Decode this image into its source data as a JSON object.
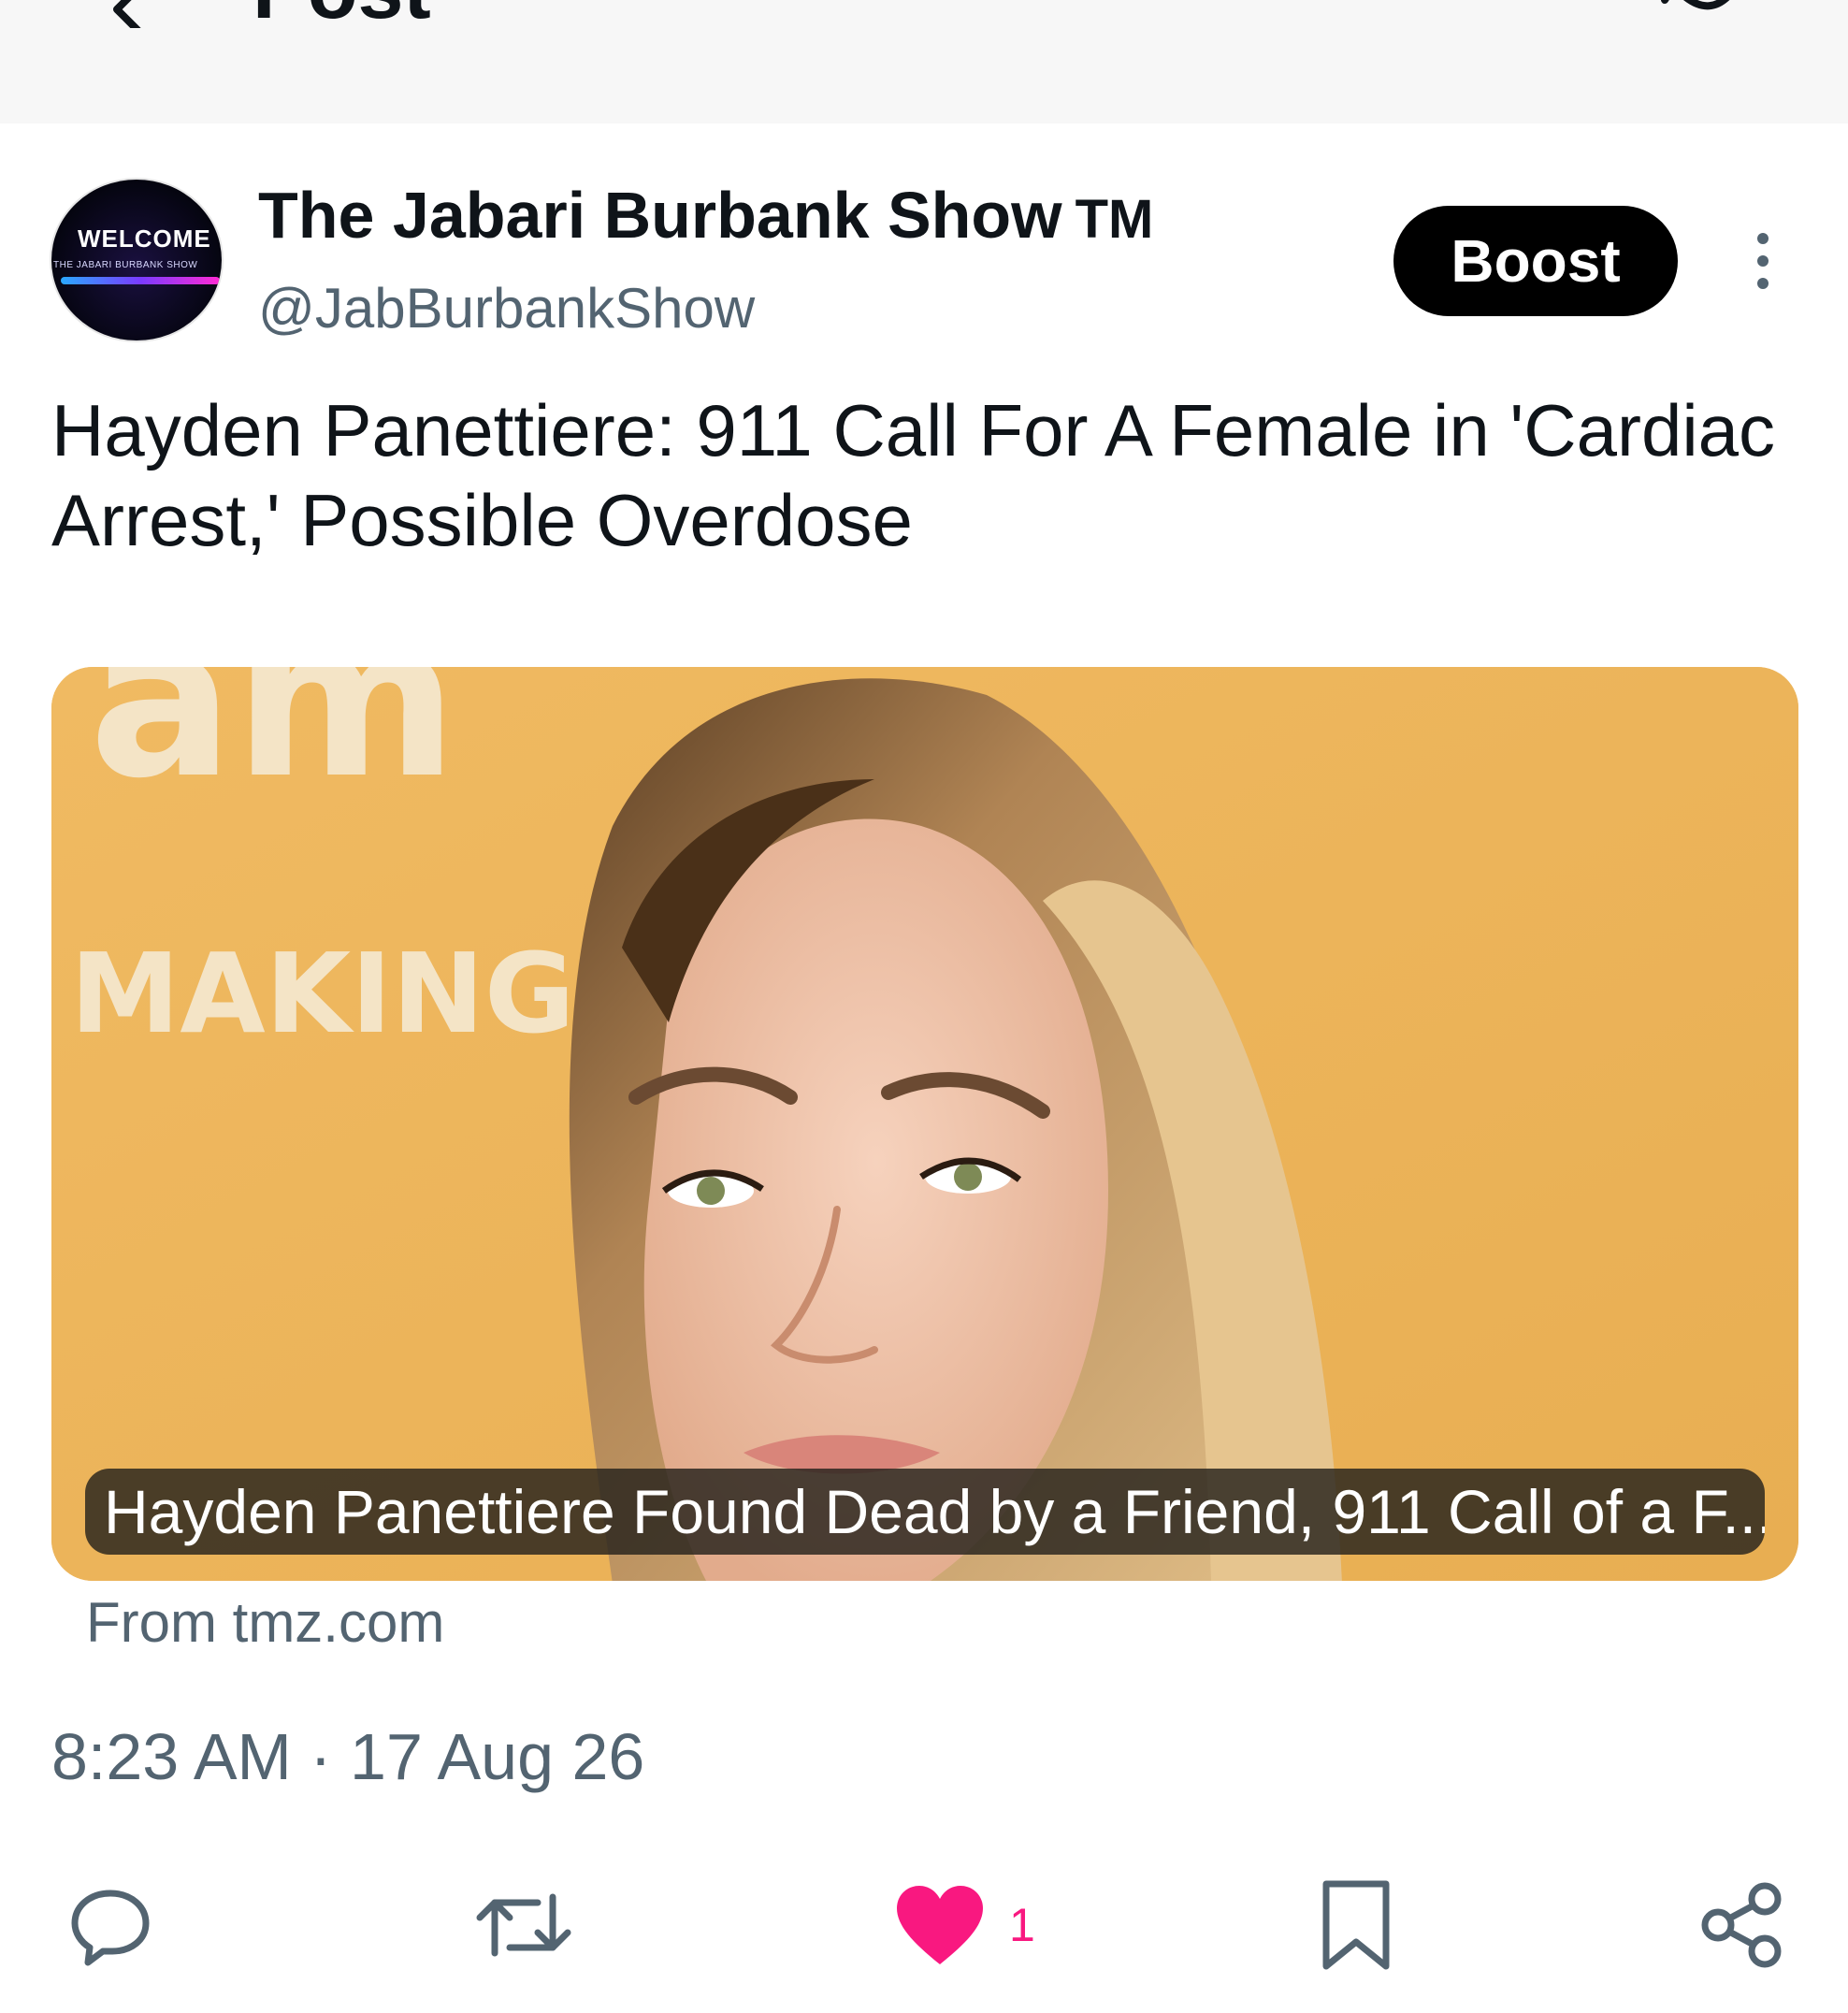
{
  "header": {
    "title": "Post"
  },
  "author": {
    "avatar_text": "WELCOME",
    "avatar_subtext": "THE JABARI BURBANK SHOW",
    "display_name": "The Jabari Burbank Show",
    "badge": "TM",
    "handle": "@JabBurbankShow"
  },
  "boost_label": "Boost",
  "post": {
    "text": "Hayden Panettiere: 911 Call For A Female in 'Cardiac Arrest,' Possible Overdose"
  },
  "card": {
    "background_text_1": "am",
    "background_text_2": "MAKING",
    "caption": "Hayden Panettiere Found Dead by a Friend, 911 Call of a F...",
    "source": "From tmz.com"
  },
  "timestamp": "8:23 AM · 17 Aug 26",
  "actions": {
    "reply_icon": "reply-icon",
    "repost_icon": "repost-icon",
    "like_icon": "heart-icon",
    "like_count": "1",
    "bookmark_icon": "bookmark-icon",
    "share_icon": "share-icon"
  },
  "colors": {
    "accent_like": "#f91880",
    "secondary_text": "#536471",
    "card_background": "#edb65e"
  }
}
